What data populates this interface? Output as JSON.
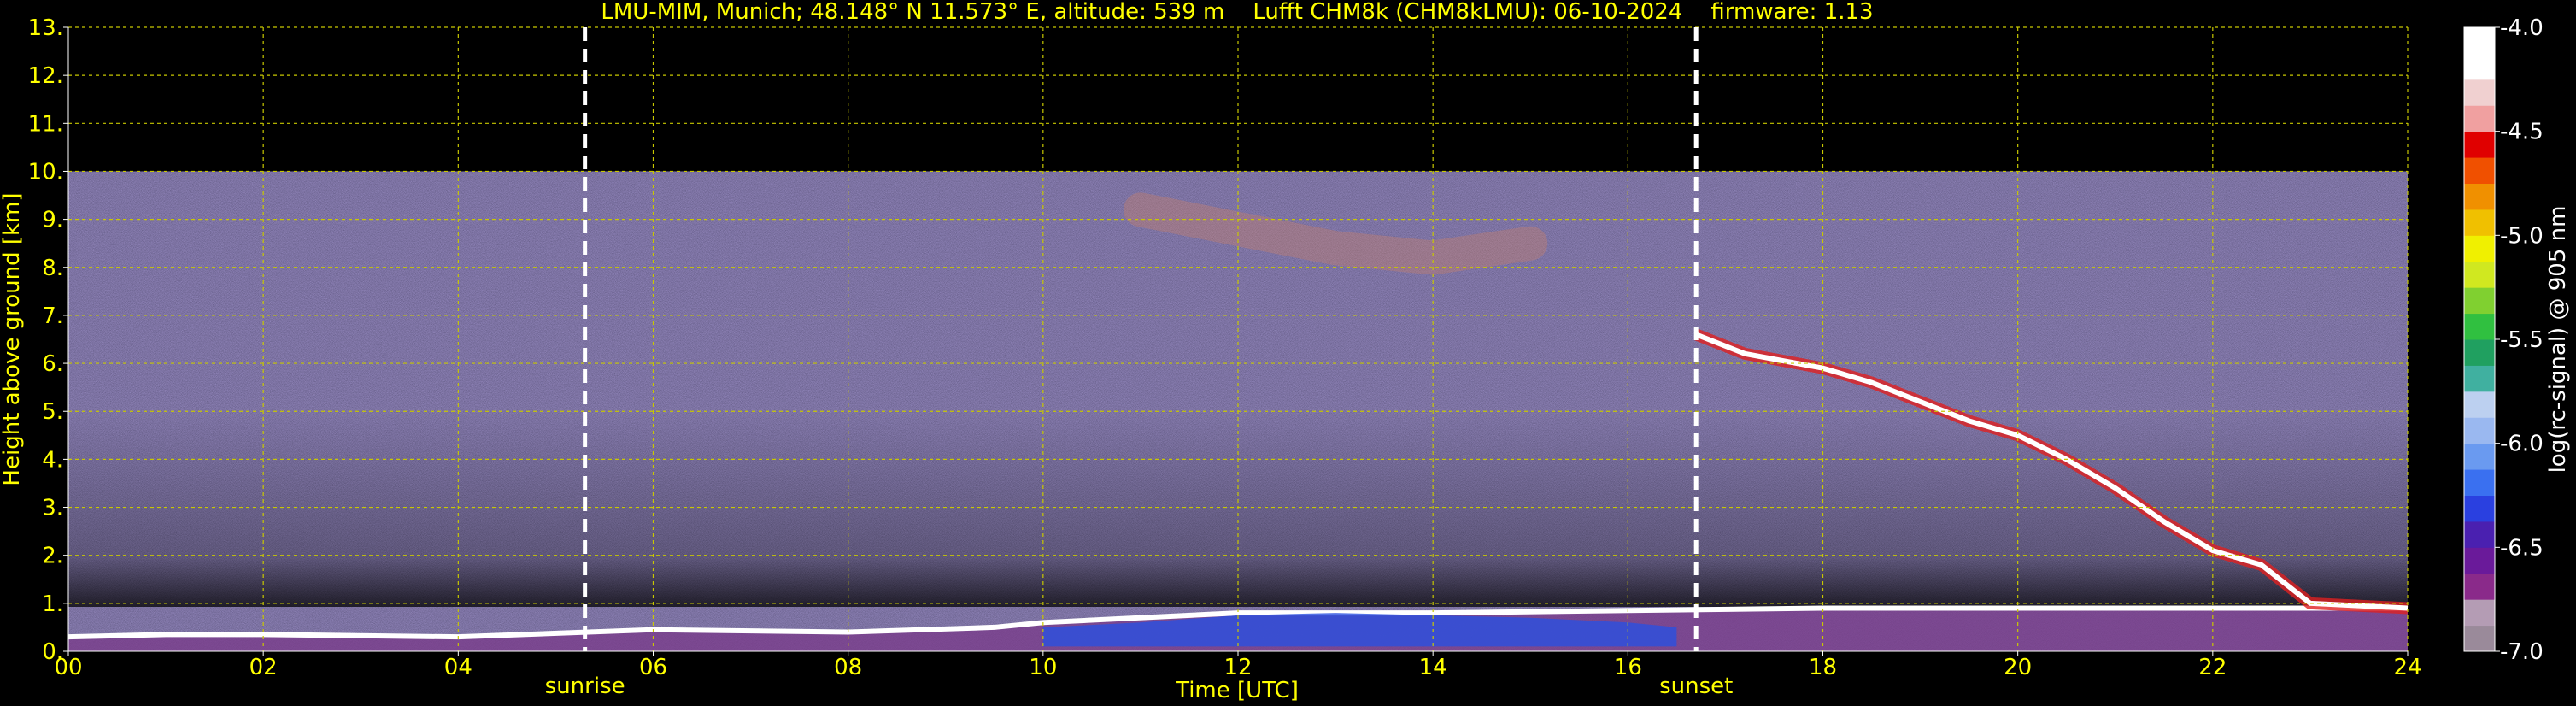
{
  "chart_data": {
    "type": "heatmap",
    "title": "LMU-MIM, Munich; 48.148° N 11.573° E, altitude: 539 m    Lufft CHM8k (CHM8kLMU): 06-10-2024    firmware: 1.13",
    "xlabel": "Time [UTC]",
    "ylabel": "Height above ground [km]",
    "xlim": [
      0,
      24
    ],
    "ylim": [
      0,
      13
    ],
    "x_ticks": [
      0,
      2,
      4,
      6,
      8,
      10,
      12,
      14,
      16,
      18,
      20,
      22,
      24
    ],
    "x_tick_labels": [
      "00",
      "02",
      "04",
      "06",
      "08",
      "10",
      "12",
      "14",
      "16",
      "18",
      "20",
      "22",
      "24"
    ],
    "y_ticks": [
      0,
      1,
      2,
      3,
      4,
      5,
      6,
      7,
      8,
      9,
      10,
      11,
      12,
      13
    ],
    "y_tick_labels": [
      "0.",
      "1.",
      "2.",
      "3.",
      "4.",
      "5.",
      "6.",
      "7.",
      "8.",
      "9.",
      "10.",
      "11.",
      "12.",
      "13."
    ],
    "grid": true,
    "data_ceiling_km": 10,
    "markers": [
      {
        "label": "sunrise",
        "time": 5.3
      },
      {
        "label": "sunset",
        "time": 16.7
      }
    ],
    "features": {
      "boundary_layer": [
        [
          0,
          0.3
        ],
        [
          1,
          0.35
        ],
        [
          2,
          0.35
        ],
        [
          4,
          0.3
        ],
        [
          6,
          0.45
        ],
        [
          8,
          0.4
        ],
        [
          9.5,
          0.5
        ],
        [
          10,
          0.6
        ],
        [
          12,
          0.8
        ],
        [
          14,
          0.8
        ],
        [
          16,
          0.85
        ],
        [
          18,
          0.9
        ],
        [
          20,
          0.9
        ],
        [
          22,
          0.9
        ],
        [
          24,
          0.9
        ]
      ],
      "cloud_layer": [
        [
          16.7,
          6.6
        ],
        [
          17.2,
          6.2
        ],
        [
          18,
          5.9
        ],
        [
          18.5,
          5.6
        ],
        [
          19,
          5.2
        ],
        [
          19.5,
          4.8
        ],
        [
          20,
          4.5
        ],
        [
          20.5,
          4.0
        ],
        [
          21,
          3.4
        ],
        [
          21.5,
          2.7
        ],
        [
          22,
          2.1
        ],
        [
          22.5,
          1.8
        ],
        [
          23,
          1.0
        ],
        [
          24,
          0.9
        ]
      ],
      "cirrus": [
        [
          11,
          9.2
        ],
        [
          12,
          8.8
        ],
        [
          13,
          8.4
        ],
        [
          14,
          8.2
        ],
        [
          15,
          8.5
        ]
      ]
    },
    "colorbar": {
      "label": "log(rc-signal) @ 905 nm",
      "ticks": [
        -4.0,
        -4.5,
        -5.0,
        -5.5,
        -6.0,
        -6.5,
        -7.0
      ],
      "tick_labels": [
        "-4.0",
        "-4.5",
        "-5.0",
        "-5.5",
        "-6.0",
        "-6.5",
        "-7.0"
      ],
      "range": [
        -7.0,
        -4.0
      ],
      "colors": [
        "#9a8a9a",
        "#b49cb4",
        "#8a2a8a",
        "#6a1a9a",
        "#4a20b0",
        "#2a40e0",
        "#3a70f0",
        "#6a9af0",
        "#9ab8f0",
        "#bcd0f0",
        "#40b0a0",
        "#20a060",
        "#30c040",
        "#80d030",
        "#d0e820",
        "#f0f000",
        "#f0c000",
        "#f09000",
        "#f05000",
        "#e00000",
        "#f0a0a0",
        "#f0d0d0",
        "#ffffff",
        "#ffffff"
      ]
    }
  }
}
